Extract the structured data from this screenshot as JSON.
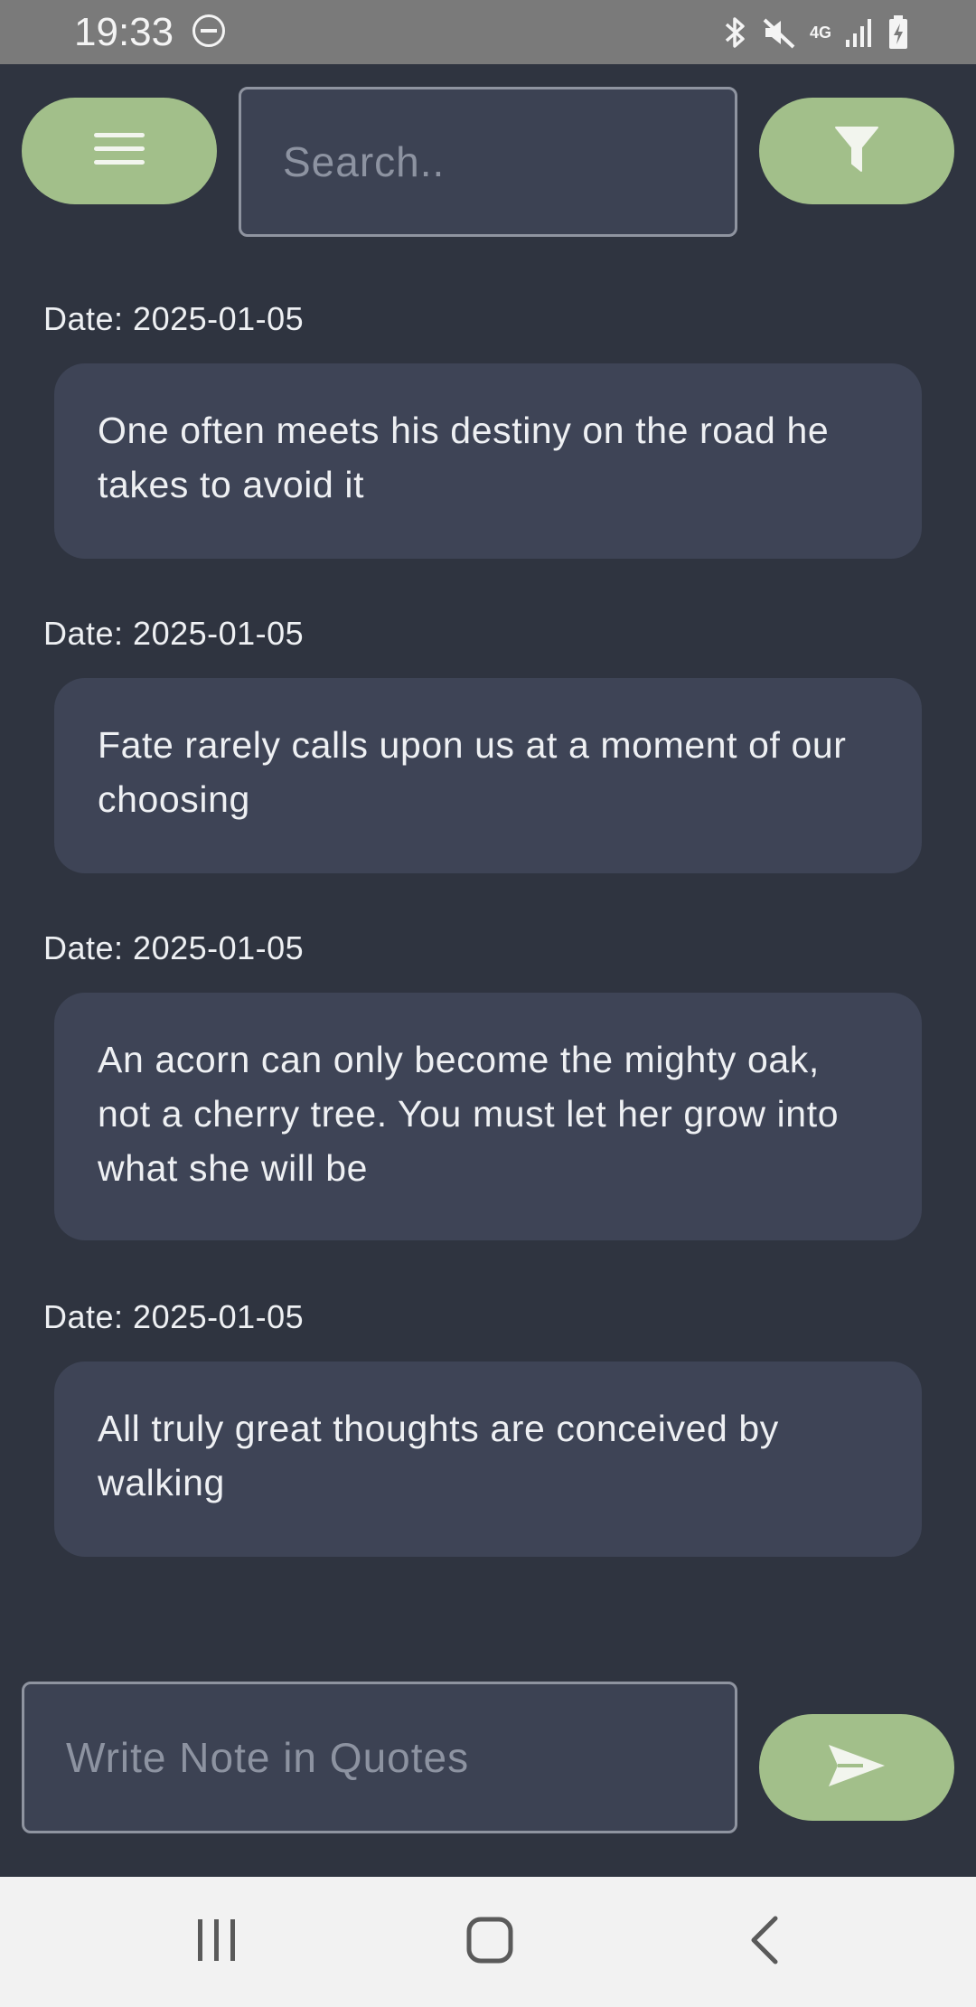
{
  "status_bar": {
    "time": "19:33",
    "network": "4G"
  },
  "top_bar": {
    "menu_icon": "hamburger-menu-icon",
    "search_placeholder": "Search..",
    "filter_icon": "filter-funnel-icon"
  },
  "notes": [
    {
      "date": "Date: 2025-01-05",
      "text": "One often meets his destiny on the road he takes to avoid it"
    },
    {
      "date": "Date: 2025-01-05",
      "text": "Fate rarely calls upon us at a moment of our choosing"
    },
    {
      "date": "Date: 2025-01-05",
      "text": "An acorn can only become the mighty oak, not a cherry tree. You must let her grow into what she will be"
    },
    {
      "date": "Date: 2025-01-05",
      "text": "All truly great thoughts are conceived by walking"
    }
  ],
  "composer": {
    "placeholder": "Write Note in Quotes",
    "send_icon": "send-icon"
  },
  "colors": {
    "background": "#2f3440",
    "card": "#3e4456",
    "accent": "#a2bf8a",
    "input_border": "#8f94a0"
  }
}
